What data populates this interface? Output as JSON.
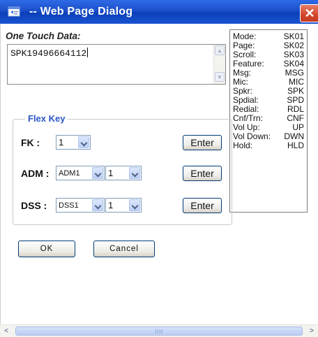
{
  "window": {
    "title": "-- Web Page Dialog",
    "close_glyph": "✕"
  },
  "one_touch": {
    "label": "One Touch Data:",
    "value": "SPK19496664112"
  },
  "flex_key": {
    "legend": "Flex Key",
    "fk": {
      "label": "FK :",
      "value": "1",
      "button": "Enter"
    },
    "adm": {
      "label": "ADM :",
      "select1": "ADM1",
      "select2": "1",
      "button": "Enter"
    },
    "dss": {
      "label": "DSS :",
      "select1": "DSS1",
      "select2": "1",
      "button": "Enter"
    }
  },
  "buttons": {
    "ok": "OK",
    "cancel": "Cancel"
  },
  "legend": {
    "rows": [
      {
        "name": "Mode:",
        "code": "SK01"
      },
      {
        "name": "Page:",
        "code": "SK02"
      },
      {
        "name": "Scroll:",
        "code": "SK03"
      },
      {
        "name": "Feature:",
        "code": "SK04"
      },
      {
        "name": "Msg:",
        "code": "MSG"
      },
      {
        "name": "Mic:",
        "code": "MIC"
      },
      {
        "name": "Spkr:",
        "code": "SPK"
      },
      {
        "name": "Spdial:",
        "code": "SPD"
      },
      {
        "name": "Redial:",
        "code": "RDL"
      },
      {
        "name": "Cnf/Trn:",
        "code": "CNF"
      },
      {
        "name": "Vol Up:",
        "code": "UP"
      },
      {
        "name": "Vol Down:",
        "code": "DWN"
      },
      {
        "name": "Hold:",
        "code": "HLD"
      }
    ]
  },
  "scrollbar": {
    "left_glyph": "<",
    "right_glyph": ">",
    "grip": "III"
  },
  "icons": {
    "app": "dialog-window-icon",
    "close": "close-icon",
    "dropdown": "chevron-down-icon"
  },
  "colors": {
    "titlebar": "#1b4fc8",
    "close": "#d2452a",
    "legend_text": "#2a56c6"
  }
}
